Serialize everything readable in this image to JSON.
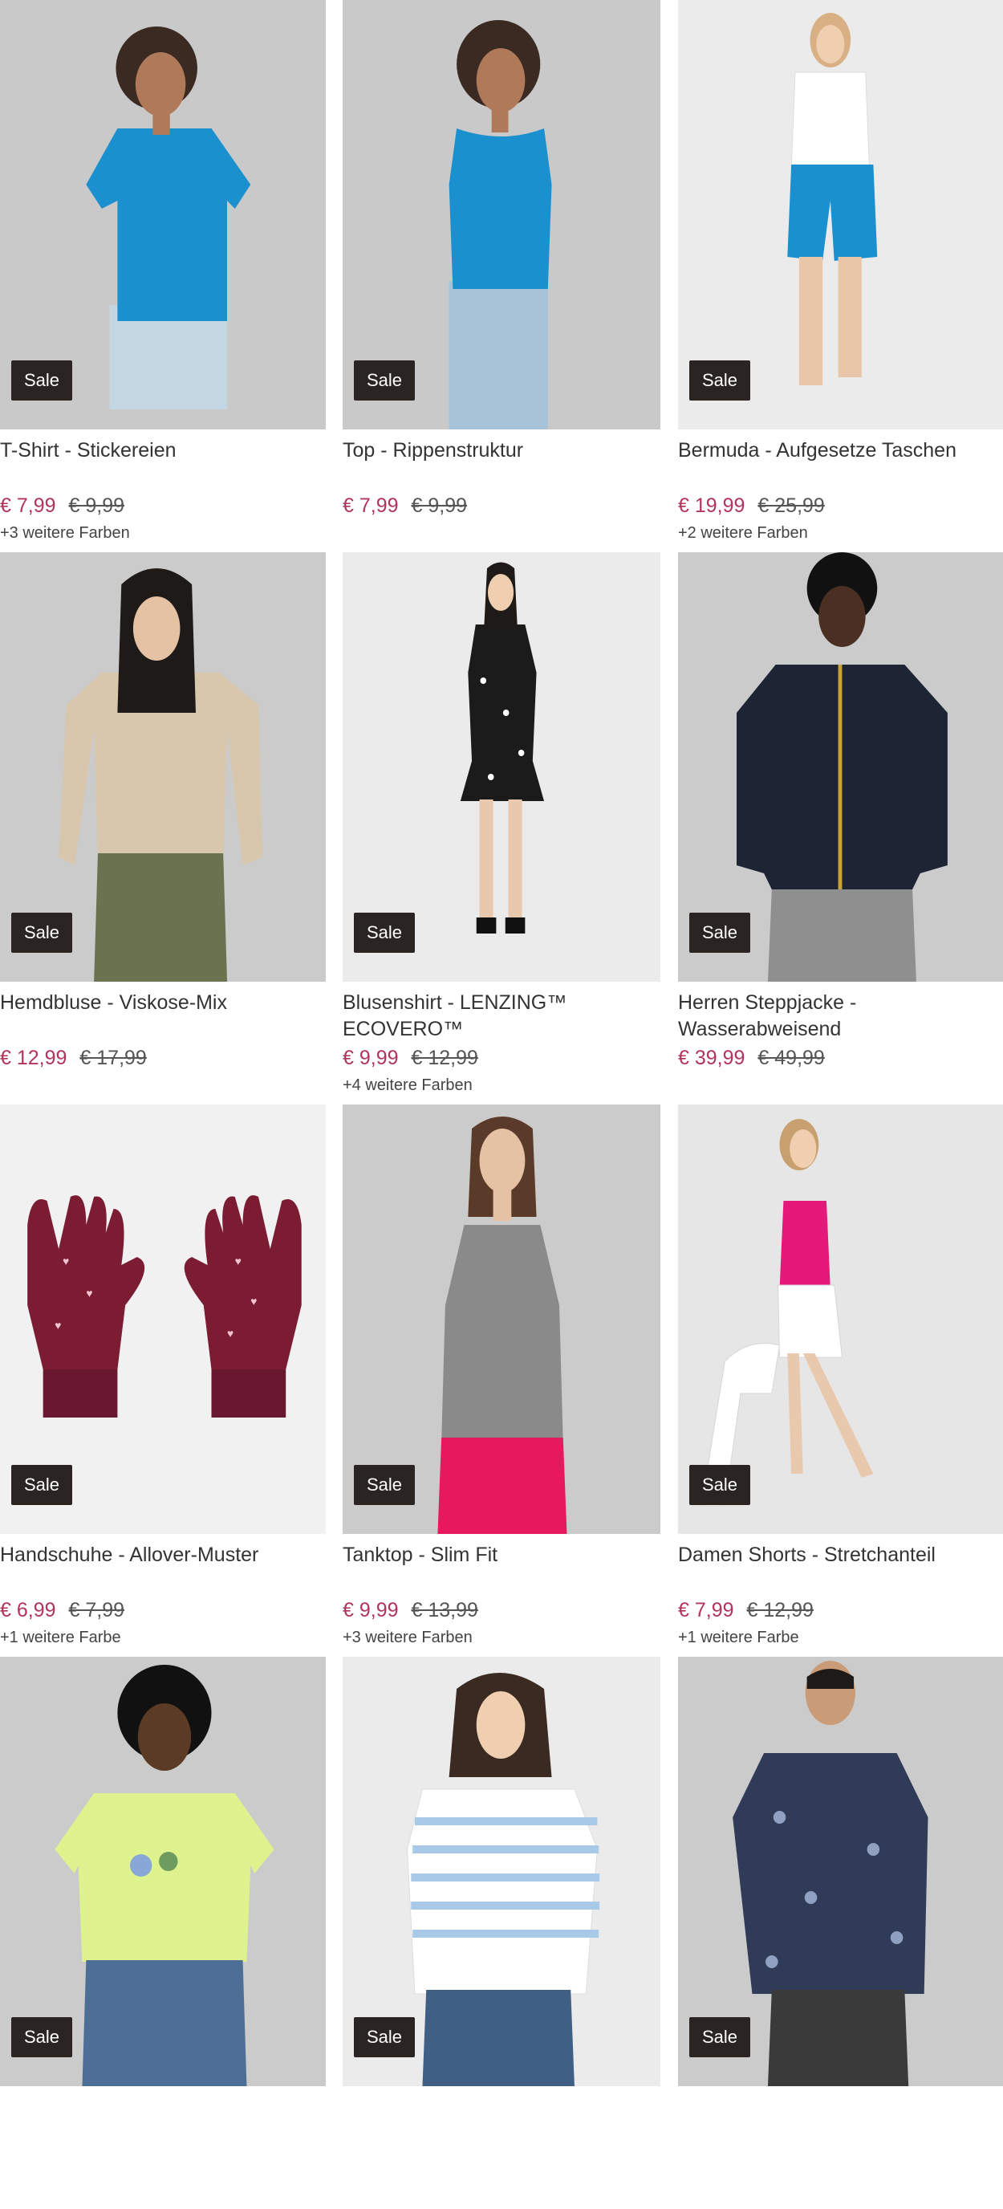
{
  "badge_label": "Sale",
  "colors": {
    "sale_price": "#b1345b",
    "badge_bg": "#2a2523"
  },
  "products": [
    {
      "title": "T-Shirt - Stickereien",
      "price": "€ 7,99",
      "old_price": "€ 9,99",
      "more_colors": "+3 weitere Farben",
      "image": "woman-blue-tshirt"
    },
    {
      "title": "Top - Rippenstruktur",
      "price": "€ 7,99",
      "old_price": "€ 9,99",
      "more_colors": "",
      "image": "woman-blue-tank-top"
    },
    {
      "title": "Bermuda - Aufgesetze Taschen",
      "price": "€ 19,99",
      "old_price": "€ 25,99",
      "more_colors": "+2 weitere Farben",
      "image": "woman-blue-bermuda"
    },
    {
      "title": "Hemdbluse - Viskose-Mix",
      "price": "€ 12,99",
      "old_price": "€ 17,99",
      "more_colors": "",
      "image": "woman-beige-blouse"
    },
    {
      "title": "Blusenshirt - LENZING™ ECOVERO™",
      "price": "€ 9,99",
      "old_price": "€ 12,99",
      "more_colors": "+4 weitere Farben",
      "image": "woman-floral-dress"
    },
    {
      "title": "Herren Steppjacke - Wasserabweisend",
      "price": "€ 39,99",
      "old_price": "€ 49,99",
      "more_colors": "",
      "image": "man-navy-jacket"
    },
    {
      "title": "Handschuhe - Allover-Muster",
      "price": "€ 6,99",
      "old_price": "€ 7,99",
      "more_colors": "+1 weitere Farbe",
      "image": "burgundy-gloves"
    },
    {
      "title": "Tanktop - Slim Fit",
      "price": "€ 9,99",
      "old_price": "€ 13,99",
      "more_colors": "+3 weitere Farben",
      "image": "woman-grey-tank"
    },
    {
      "title": "Damen Shorts - Stretchanteil",
      "price": "€ 7,99",
      "old_price": "€ 12,99",
      "more_colors": "+1 weitere Farbe",
      "image": "woman-white-shorts"
    },
    {
      "title": "",
      "price": "",
      "old_price": "",
      "more_colors": "",
      "image": "woman-yellow-tshirt"
    },
    {
      "title": "",
      "price": "",
      "old_price": "",
      "more_colors": "",
      "image": "woman-striped-shirt"
    },
    {
      "title": "",
      "price": "",
      "old_price": "",
      "more_colors": "",
      "image": "man-floral-shirt"
    }
  ]
}
